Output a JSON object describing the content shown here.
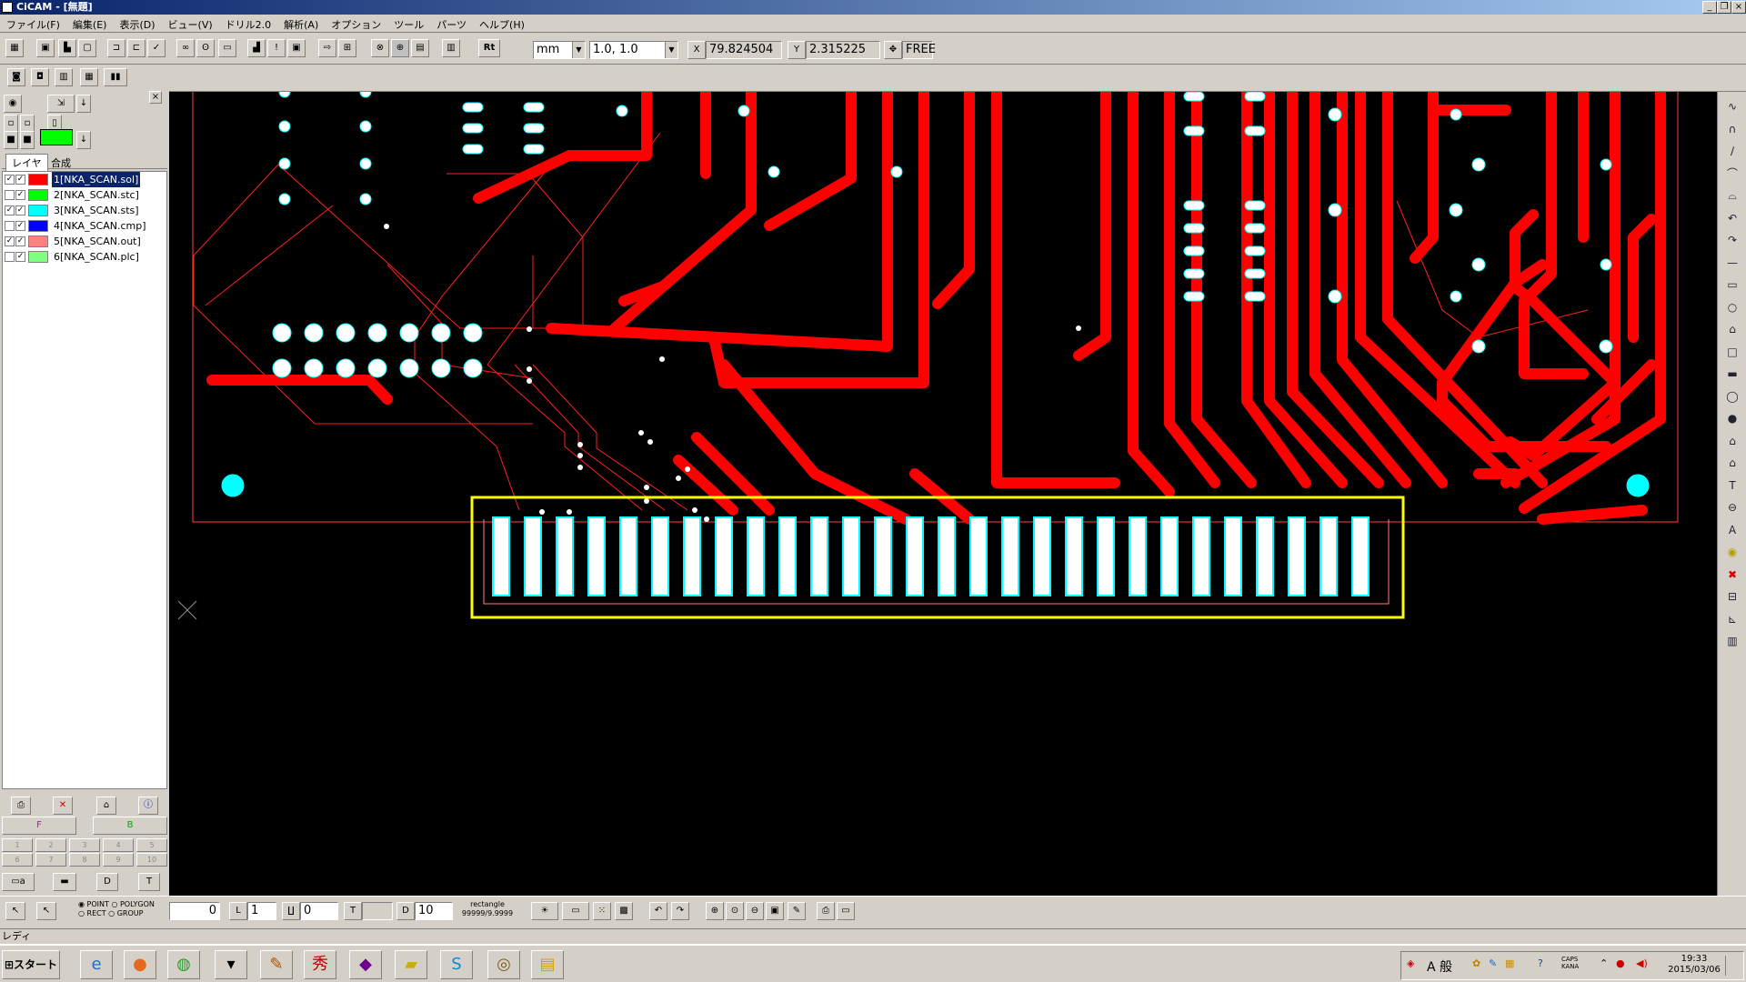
{
  "window": {
    "title": "CiCAM - [無題]",
    "controls": [
      "_",
      "❐",
      "×"
    ]
  },
  "menu": [
    "ファイル(F)",
    "編集(E)",
    "表示(D)",
    "ビュー(V)",
    "ドリル2.0",
    "解析(A)",
    "オプション",
    "ツール",
    "パーツ",
    "ヘルプ(H)"
  ],
  "toolbar": {
    "unit_value": "mm",
    "grid_value": "1.0, 1.0",
    "x_coord": "79.824504",
    "y_coord": "2.315225",
    "snap_mode": "FREE",
    "rt_label": "Rt"
  },
  "left_panel": {
    "tabs": [
      "レイヤ",
      "合成"
    ],
    "layers": [
      {
        "label": "1[NKA_SCAN.sol]",
        "color": "#ff0000",
        "checked1": true,
        "checked2": true
      },
      {
        "label": "2[NKA_SCAN.stc]",
        "color": "#00ff00",
        "checked1": false,
        "checked2": true
      },
      {
        "label": "3[NKA_SCAN.sts]",
        "color": "#00ffff",
        "checked1": true,
        "checked2": true
      },
      {
        "label": "4[NKA_SCAN.cmp]",
        "color": "#0000ff",
        "checked1": false,
        "checked2": true
      },
      {
        "label": "5[NKA_SCAN.out]",
        "color": "#ff8080",
        "checked1": true,
        "checked2": true
      },
      {
        "label": "6[NKA_SCAN.plc]",
        "color": "#80ff80",
        "checked1": false,
        "checked2": true
      }
    ],
    "active_color": "#00ff00",
    "numpad": [
      "1",
      "2",
      "3",
      "4",
      "5",
      "6",
      "7",
      "8",
      "9",
      "10"
    ]
  },
  "bottom_bar": {
    "radio_point": "POINT",
    "radio_polygon": "POLYGON",
    "radio_rect": "RECT",
    "radio_group": "GROUP",
    "field_zero": "0",
    "field_one": "1",
    "field_0": "0",
    "field_10": "10",
    "rect_label": "rectangle",
    "rect_value": "99999/9.9999"
  },
  "status_text": "レディ",
  "taskbar": {
    "start_label": "スタート",
    "ime_label": "A 般",
    "caps": "CAPS",
    "kana": "KANA",
    "time": "19:33",
    "date": "2015/03/06"
  }
}
